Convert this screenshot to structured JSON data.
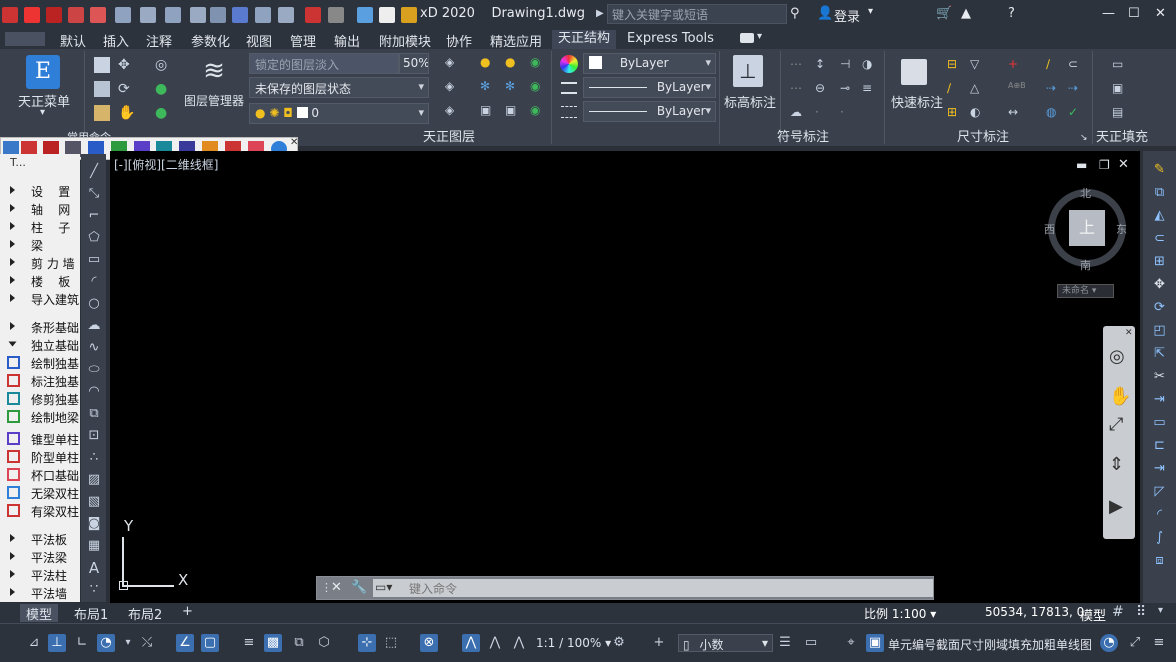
{
  "app": {
    "title": "xD 2020    Drawing1.dwg",
    "search_placeholder": "键入关键字或短语",
    "login": "登录"
  },
  "ribbon_tabs": [
    "默认",
    "插入",
    "注释",
    "参数化",
    "视图",
    "管理",
    "输出",
    "附加模块",
    "协作",
    "精选应用",
    "天正结构",
    "Express Tools"
  ],
  "active_tab": "天正结构",
  "ribbon": {
    "tianzheng_menu": "天正菜单",
    "common_cmds_label": "常用命令",
    "layer_manager": "图层管理器",
    "locked_layer_fade": "锁定的图层淡入",
    "fade_percent": "50%",
    "layer_state": "未保存的图层状态",
    "layer_current": "0",
    "bylayer_color": "ByLayer",
    "bylayer_linetype": "ByLayer",
    "bylayer_lineweight": "ByLayer",
    "layers_panel_label": "天正图层",
    "elevation_label": "标高标注",
    "symbol_panel_label": "符号标注",
    "quick_dim": "快速标注",
    "dim_panel_label": "尺寸标注",
    "fill_panel_label": "天正填充"
  },
  "viewport": {
    "label": "[-][俯视][二维线框]",
    "compass": {
      "north": "北",
      "south": "南",
      "east": "东",
      "west": "西",
      "top": "上"
    },
    "ucs_name": "未命名",
    "ucs_y": "Y",
    "ucs_x": "X"
  },
  "command_line": {
    "placeholder": "键入命令"
  },
  "left_palette": {
    "header": "T...",
    "items": [
      {
        "label": "设    置",
        "type": "arrow"
      },
      {
        "label": "轴    网",
        "type": "arrow"
      },
      {
        "label": "柱    子",
        "type": "arrow"
      },
      {
        "label": "梁",
        "type": "arrow"
      },
      {
        "label": "剪 力 墙",
        "type": "arrow"
      },
      {
        "label": "楼    板",
        "type": "arrow"
      },
      {
        "label": "导入建筑",
        "type": "arrow"
      },
      {
        "label": "条形基础",
        "type": "arrow"
      },
      {
        "label": "独立基础",
        "type": "open"
      },
      {
        "label": "绘制独基",
        "type": "icon"
      },
      {
        "label": "标注独基",
        "type": "icon"
      },
      {
        "label": "修剪独基",
        "type": "icon"
      },
      {
        "label": "绘制地梁",
        "type": "icon"
      },
      {
        "label": "锥型单柱",
        "type": "icon"
      },
      {
        "label": "阶型单柱",
        "type": "icon"
      },
      {
        "label": "杯口基础",
        "type": "icon"
      },
      {
        "label": "无梁双柱",
        "type": "icon"
      },
      {
        "label": "有梁双柱",
        "type": "icon"
      },
      {
        "label": "平法板",
        "type": "arrow"
      },
      {
        "label": "平法梁",
        "type": "arrow"
      },
      {
        "label": "平法柱",
        "type": "arrow"
      },
      {
        "label": "平法墙",
        "type": "arrow"
      }
    ]
  },
  "layout_tabs": [
    "模型",
    "布局1",
    "布局2"
  ],
  "status": {
    "scale": "比例 1:100",
    "coords": "50534, 17813, 0",
    "model": "模型",
    "zoom": "1:1 / 100%",
    "units": "小数",
    "hint": "单元编号截面尺寸刚域填充加粗单线图"
  },
  "colors": {
    "accent": "#3b6fb0",
    "canvas": "#000000",
    "ribbon": "#3a414d"
  }
}
